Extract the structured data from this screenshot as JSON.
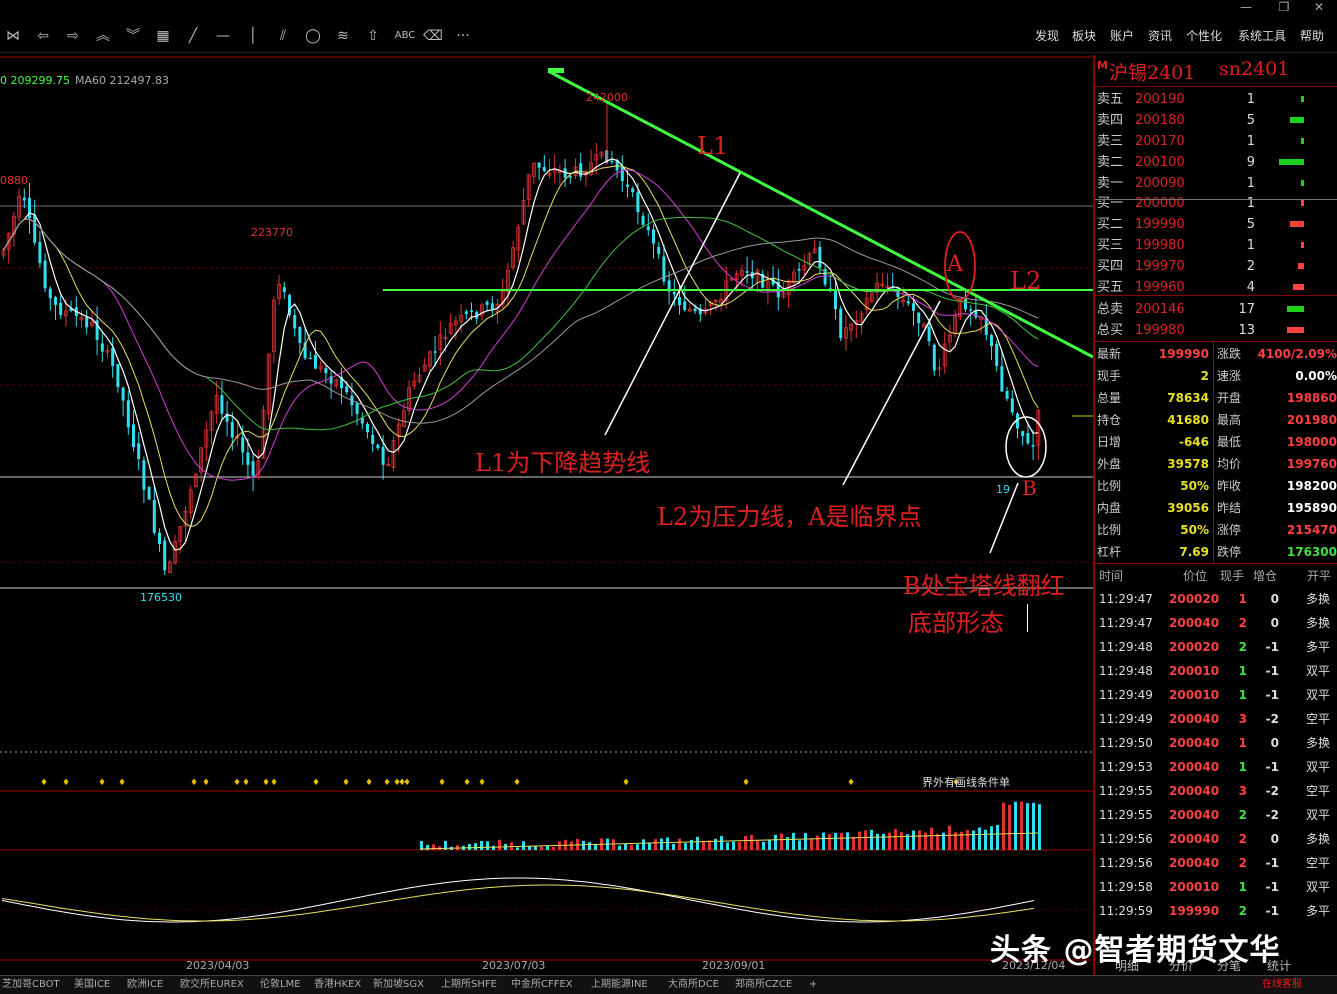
{
  "window": {
    "controls": [
      "—",
      "❐",
      "✕"
    ]
  },
  "toolbar": {
    "menus": [
      "发现",
      "板块",
      "账户",
      "资讯",
      "个性化",
      "系统工具",
      "帮助"
    ],
    "text_tool": "ABC",
    "more": "···"
  },
  "chart": {
    "ma_readout": {
      "ma_partial": "0 209299.75",
      "ma60": "MA60 212497.83"
    },
    "price_labels": {
      "p_left": "0880",
      "p_223770": "223770",
      "p_242000": "242000",
      "p_176530": "176530",
      "p_bottom": "19"
    },
    "annotations": {
      "l1_tag": "L1",
      "l2_tag": "L2",
      "a_tag": "A",
      "b_tag": "B",
      "l1_desc": "L1为下降趋势线",
      "l2_desc": "L2为压力线，A是临界点",
      "b_desc1": "B处宝塔线翻红",
      "b_desc2": "底部形态"
    },
    "signal_label": "界外有画线条件单",
    "dates": [
      "2023/04/03",
      "2023/07/03",
      "2023/09/01",
      "2023/12/04"
    ],
    "colors": {
      "up": "#e03030",
      "down": "#30e0f0",
      "trend": "#40ff40"
    }
  },
  "panel": {
    "marker": "M",
    "title": "沪锡2401",
    "code": "sn2401",
    "asks": [
      {
        "label": "卖五",
        "price": "200190",
        "qty": "1"
      },
      {
        "label": "卖四",
        "price": "200180",
        "qty": "5"
      },
      {
        "label": "卖三",
        "price": "200170",
        "qty": "1"
      },
      {
        "label": "卖二",
        "price": "200100",
        "qty": "9"
      },
      {
        "label": "卖一",
        "price": "200090",
        "qty": "1"
      }
    ],
    "bids": [
      {
        "label": "买一",
        "price": "200000",
        "qty": "1"
      },
      {
        "label": "买二",
        "price": "199990",
        "qty": "5"
      },
      {
        "label": "买三",
        "price": "199980",
        "qty": "1"
      },
      {
        "label": "买四",
        "price": "199970",
        "qty": "2"
      },
      {
        "label": "买五",
        "price": "199960",
        "qty": "4"
      }
    ],
    "totals": [
      {
        "label": "总卖",
        "price": "200146",
        "qty": "17"
      },
      {
        "label": "总买",
        "price": "199980",
        "qty": "13"
      }
    ],
    "stats": [
      {
        "l1": "最新",
        "v1": "199990",
        "l2": "涨跌",
        "v2": "4100/2.09%"
      },
      {
        "l1": "现手",
        "v1": "2",
        "l2": "速涨",
        "v2": "0.00%"
      },
      {
        "l1": "总量",
        "v1": "78634",
        "l2": "开盘",
        "v2": "198860"
      },
      {
        "l1": "持仓",
        "v1": "41680",
        "l2": "最高",
        "v2": "201980"
      },
      {
        "l1": "日增",
        "v1": "-646",
        "l2": "最低",
        "v2": "198000"
      },
      {
        "l1": "外盘",
        "v1": "39578",
        "l2": "均价",
        "v2": "199760"
      },
      {
        "l1": "比例",
        "v1": "50%",
        "l2": "昨收",
        "v2": "198200"
      },
      {
        "l1": "内盘",
        "v1": "39056",
        "l2": "昨结",
        "v2": "195890"
      },
      {
        "l1": "比例",
        "v1": "50%",
        "l2": "涨停",
        "v2": "215470"
      },
      {
        "l1": "杠杆",
        "v1": "7.69",
        "l2": "跌停",
        "v2": "176300"
      }
    ],
    "ticks_header": [
      "时间",
      "价位",
      "现手",
      "增仓",
      "开平"
    ],
    "ticks": [
      {
        "time": "11:29:47",
        "price": "200020",
        "vol": "1",
        "oi": "0",
        "type": "多换"
      },
      {
        "time": "11:29:47",
        "price": "200040",
        "vol": "2",
        "oi": "0",
        "type": "多换"
      },
      {
        "time": "11:29:48",
        "price": "200020",
        "vol": "2",
        "oi": "-1",
        "type": "多平"
      },
      {
        "time": "11:29:48",
        "price": "200010",
        "vol": "1",
        "oi": "-1",
        "type": "双平"
      },
      {
        "time": "11:29:49",
        "price": "200010",
        "vol": "1",
        "oi": "-1",
        "type": "双平"
      },
      {
        "time": "11:29:49",
        "price": "200040",
        "vol": "3",
        "oi": "-2",
        "type": "空平"
      },
      {
        "time": "11:29:50",
        "price": "200040",
        "vol": "1",
        "oi": "0",
        "type": "多换"
      },
      {
        "time": "11:29:53",
        "price": "200040",
        "vol": "1",
        "oi": "-1",
        "type": "双平"
      },
      {
        "time": "11:29:55",
        "price": "200040",
        "vol": "3",
        "oi": "-2",
        "type": "空平"
      },
      {
        "time": "11:29:55",
        "price": "200040",
        "vol": "2",
        "oi": "-2",
        "type": "双平"
      },
      {
        "time": "11:29:56",
        "price": "200040",
        "vol": "2",
        "oi": "0",
        "type": "多换"
      },
      {
        "time": "11:29:56",
        "price": "200040",
        "vol": "2",
        "oi": "-1",
        "type": "空平"
      },
      {
        "time": "11:29:58",
        "price": "200010",
        "vol": "1",
        "oi": "-1",
        "type": "双平"
      },
      {
        "time": "11:29:59",
        "price": "199990",
        "vol": "2",
        "oi": "-1",
        "type": "多平"
      }
    ],
    "footer_tabs": [
      "明细",
      "分价",
      "分笔",
      "统计"
    ]
  },
  "bottom_tabs": [
    "芝加哥CBOT",
    "美国ICE",
    "欧洲ICE",
    "欧交所EUREX",
    "伦敦LME",
    "香港HKEX",
    "新加坡SGX",
    "上期所SHFE",
    "中金所CFFEX",
    "上期能源INE",
    "大商所DCE",
    "郑商所CZCE",
    "+",
    "在线客服"
  ],
  "watermark": "头条 @智者期货文华"
}
